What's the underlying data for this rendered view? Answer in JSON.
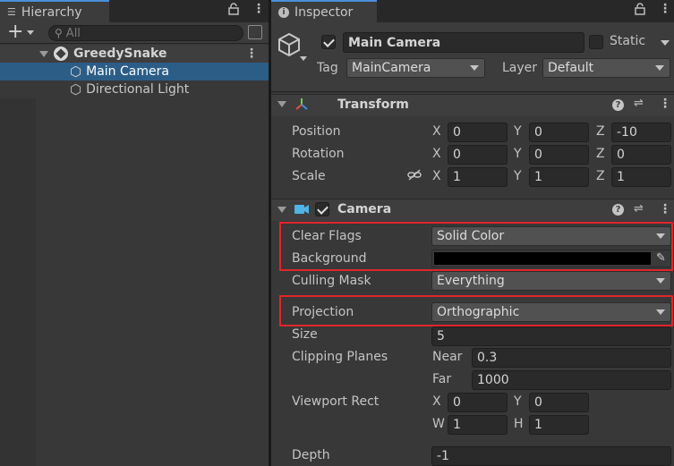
{
  "hierarchy": {
    "tab_label": "Hierarchy",
    "search_placeholder": "All",
    "add_label": "+",
    "scene": "GreedySnake",
    "items": [
      "Main Camera",
      "Directional Light"
    ]
  },
  "inspector": {
    "tab_label": "Inspector",
    "object_name": "Main Camera",
    "static_label": "Static",
    "tag_label": "Tag",
    "tag_value": "MainCamera",
    "layer_label": "Layer",
    "layer_value": "Default",
    "transform": {
      "title": "Transform",
      "rows": [
        {
          "label": "Position",
          "x": "0",
          "y": "0",
          "z": "-10"
        },
        {
          "label": "Rotation",
          "x": "0",
          "y": "0",
          "z": "0"
        },
        {
          "label": "Scale",
          "x": "1",
          "y": "1",
          "z": "1"
        }
      ],
      "axis_x": "X",
      "axis_y": "Y",
      "axis_z": "Z"
    },
    "camera": {
      "title": "Camera",
      "clear_flags_label": "Clear Flags",
      "clear_flags_value": "Solid Color",
      "background_label": "Background",
      "background_color": "#000000",
      "culling_mask_label": "Culling Mask",
      "culling_mask_value": "Everything",
      "projection_label": "Projection",
      "projection_value": "Orthographic",
      "size_label": "Size",
      "size_value": "5",
      "clipping_label": "Clipping Planes",
      "near_label": "Near",
      "near_value": "0.3",
      "far_label": "Far",
      "far_value": "1000",
      "viewport_label": "Viewport Rect",
      "vp_x_label": "X",
      "vp_x": "0",
      "vp_y_label": "Y",
      "vp_y": "0",
      "vp_w_label": "W",
      "vp_w": "1",
      "vp_h_label": "H",
      "vp_h": "1",
      "depth_label": "Depth",
      "depth_value": "-1"
    }
  },
  "colors": {
    "highlight": "#e0262b",
    "selection": "#2c5d87",
    "accent": "#4a90d9"
  }
}
